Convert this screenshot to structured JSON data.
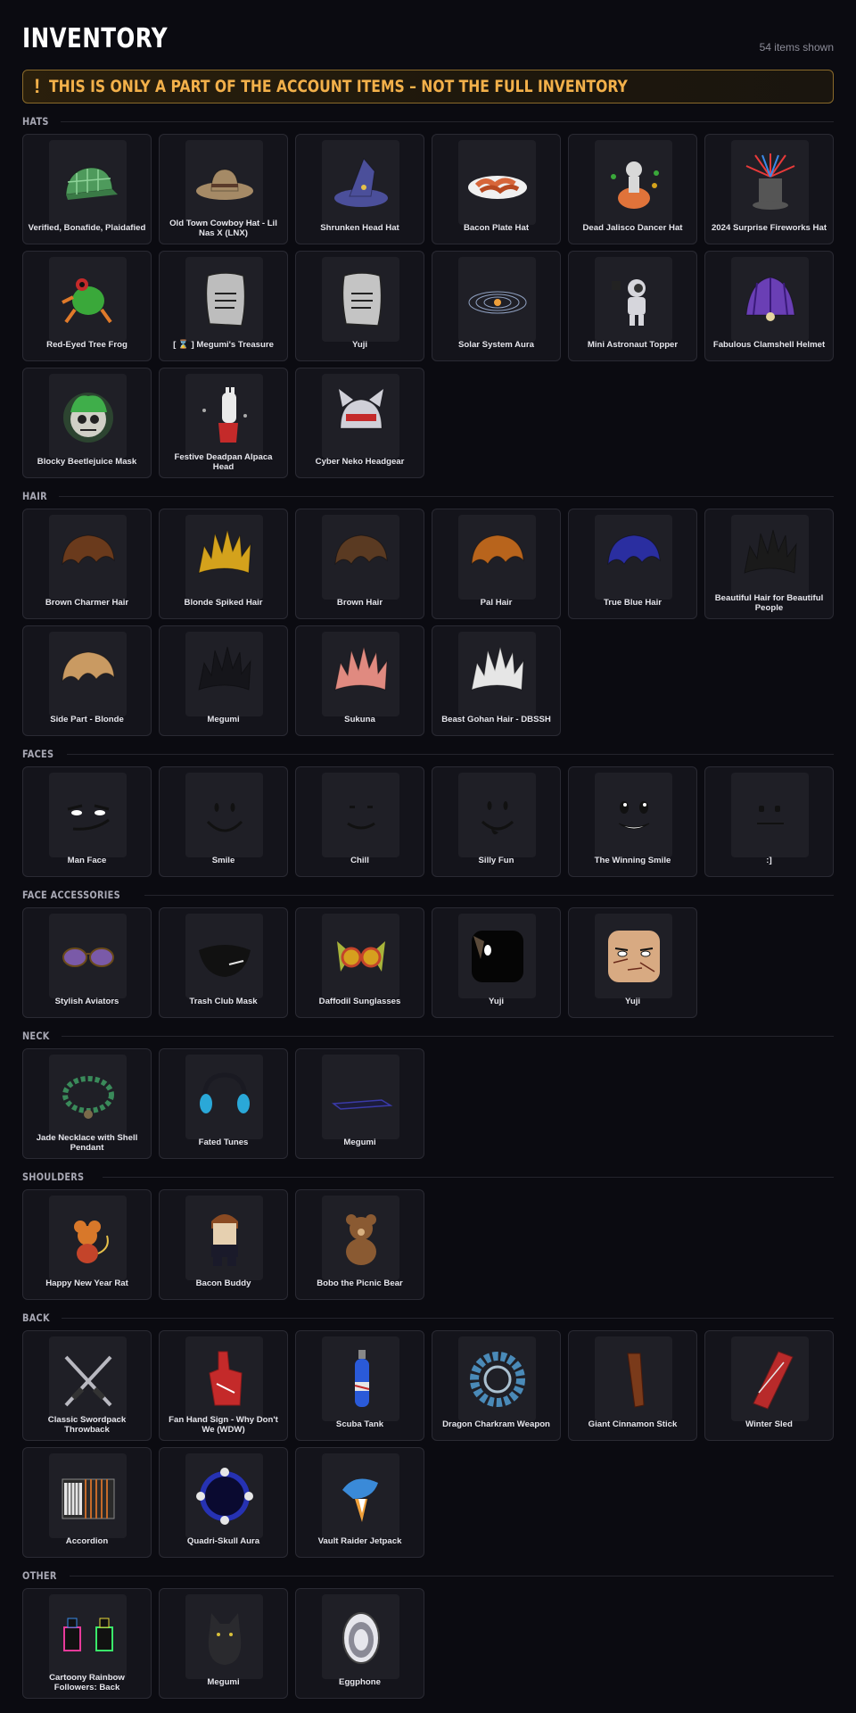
{
  "header": {
    "title": "INVENTORY",
    "count_label": "54 items shown"
  },
  "banner": {
    "icon": "!",
    "text": "THIS IS ONLY A PART OF THE ACCOUNT ITEMS – NOT THE FULL INVENTORY",
    "accent": "#f2b04a"
  },
  "sections": [
    {
      "title": "HATS",
      "items": [
        {
          "name": "Verified, Bonafide, Plaidafied",
          "icon": "plaid-cap-icon",
          "color": "#4e9a5c"
        },
        {
          "name": "Old Town Cowboy Hat - Lil Nas X (LNX)",
          "icon": "cowboy-hat-icon",
          "color": "#a58a66"
        },
        {
          "name": "Shrunken Head Hat",
          "icon": "witch-hat-icon",
          "color": "#4b4f9a"
        },
        {
          "name": "Bacon Plate Hat",
          "icon": "bacon-plate-icon",
          "color": "#d7663a"
        },
        {
          "name": "Dead Jalisco Dancer Hat",
          "icon": "skeleton-dancer-icon",
          "color": "#d8d8d8"
        },
        {
          "name": "2024 Surprise Fireworks Hat",
          "icon": "fireworks-top-hat-icon",
          "color": "#555555"
        },
        {
          "name": "Red-Eyed Tree Frog",
          "icon": "tree-frog-icon",
          "color": "#3aa83a"
        },
        {
          "name": "[ ⌛ ] Megumi's Treasure",
          "icon": "paper-note-icon",
          "color": "#bdbdbd"
        },
        {
          "name": "Yuji",
          "icon": "paper-note-icon",
          "color": "#c4c4c4"
        },
        {
          "name": "Solar System Aura",
          "icon": "solar-system-icon",
          "color": "#8fa0c0"
        },
        {
          "name": "Mini Astronaut Topper",
          "icon": "astronaut-icon",
          "color": "#d6d6dc"
        },
        {
          "name": "Fabulous Clamshell Helmet",
          "icon": "clamshell-icon",
          "color": "#6a3fb5"
        },
        {
          "name": "Blocky Beetlejuice Mask",
          "icon": "beetlejuice-mask-icon",
          "color": "#3fae4a"
        },
        {
          "name": "Festive Deadpan Alpaca Head",
          "icon": "alpaca-head-icon",
          "color": "#eaeaea"
        },
        {
          "name": "Cyber Neko Headgear",
          "icon": "cyber-neko-icon",
          "color": "#d0d0d8"
        }
      ]
    },
    {
      "title": "HAIR",
      "items": [
        {
          "name": "Brown Charmer Hair",
          "icon": "hair-icon",
          "color": "#6a3a1c"
        },
        {
          "name": "Blonde Spiked Hair",
          "icon": "spiked-hair-icon",
          "color": "#d4a21c"
        },
        {
          "name": "Brown Hair",
          "icon": "hair-icon",
          "color": "#5a3a22"
        },
        {
          "name": "Pal Hair",
          "icon": "hair-icon",
          "color": "#b8641c"
        },
        {
          "name": "True Blue Hair",
          "icon": "hair-icon",
          "color": "#2a2ea0"
        },
        {
          "name": "Beautiful Hair for Beautiful People",
          "icon": "spiked-hair-icon",
          "color": "#1a1a1a"
        },
        {
          "name": "Side Part - Blonde",
          "icon": "hair-icon",
          "color": "#c99a62"
        },
        {
          "name": "Megumi",
          "icon": "spiked-hair-icon",
          "color": "#15151a"
        },
        {
          "name": "Sukuna",
          "icon": "spiked-hair-icon",
          "color": "#e08a80"
        },
        {
          "name": "Beast Gohan Hair - DBSSH",
          "icon": "spiked-hair-icon",
          "color": "#e6e6e6"
        }
      ]
    },
    {
      "title": "FACES",
      "items": [
        {
          "name": "Man Face",
          "icon": "man-face-icon",
          "color": "#111111"
        },
        {
          "name": "Smile",
          "icon": "smile-face-icon",
          "color": "#111111"
        },
        {
          "name": "Chill",
          "icon": "chill-face-icon",
          "color": "#111111"
        },
        {
          "name": "Silly Fun",
          "icon": "silly-face-icon",
          "color": "#111111"
        },
        {
          "name": "The Winning Smile",
          "icon": "winning-smile-icon",
          "color": "#111111"
        },
        {
          "name": ":]",
          "icon": "flat-face-icon",
          "color": "#111111"
        }
      ]
    },
    {
      "title": "FACE ACCESSORIES",
      "items": [
        {
          "name": "Stylish Aviators",
          "icon": "aviators-icon",
          "color": "#7a5aa8"
        },
        {
          "name": "Trash Club Mask",
          "icon": "black-mask-icon",
          "color": "#111111"
        },
        {
          "name": "Daffodil Sunglasses",
          "icon": "daffodil-glasses-icon",
          "color": "#d6a01e"
        },
        {
          "name": "Yuji",
          "icon": "black-face-icon",
          "color": "#050505"
        },
        {
          "name": "Yuji",
          "icon": "skin-face-icon",
          "color": "#d8aa82"
        }
      ]
    },
    {
      "title": "NECK",
      "items": [
        {
          "name": "Jade Necklace with Shell Pendant",
          "icon": "necklace-icon",
          "color": "#3a8a5a"
        },
        {
          "name": "Fated Tunes",
          "icon": "headphones-icon",
          "color": "#2aa8d8"
        },
        {
          "name": "Megumi",
          "icon": "scarf-icon",
          "color": "#1c1c3a"
        }
      ]
    },
    {
      "title": "SHOULDERS",
      "items": [
        {
          "name": "Happy New Year Rat",
          "icon": "rat-icon",
          "color": "#d8782a"
        },
        {
          "name": "Bacon Buddy",
          "icon": "bacon-buddy-icon",
          "color": "#8a4a22"
        },
        {
          "name": "Bobo the Picnic Bear",
          "icon": "bear-icon",
          "color": "#8a5a32"
        }
      ]
    },
    {
      "title": "BACK",
      "items": [
        {
          "name": "Classic Swordpack Throwback",
          "icon": "crossed-swords-icon",
          "color": "#b8b8c0"
        },
        {
          "name": "Fan Hand Sign - Why Don't We (WDW)",
          "icon": "foam-finger-icon",
          "color": "#c42a2a"
        },
        {
          "name": "Scuba Tank",
          "icon": "scuba-tank-icon",
          "color": "#2a5ad8"
        },
        {
          "name": "Dragon Charkram Weapon",
          "icon": "chakram-icon",
          "color": "#4a8ab8"
        },
        {
          "name": "Giant Cinnamon Stick",
          "icon": "cinnamon-stick-icon",
          "color": "#7a3a1a"
        },
        {
          "name": "Winter Sled",
          "icon": "sled-icon",
          "color": "#b82a2a"
        },
        {
          "name": "Accordion",
          "icon": "accordion-icon",
          "color": "#2a2a2a"
        },
        {
          "name": "Quadri-Skull Aura",
          "icon": "skull-ring-icon",
          "color": "#2a3af0"
        },
        {
          "name": "Vault Raider Jetpack",
          "icon": "jetpack-icon",
          "color": "#3a8ad8"
        }
      ]
    },
    {
      "title": "OTHER",
      "items": [
        {
          "name": "Cartoony Rainbow Followers: Back",
          "icon": "rainbow-figures-icon",
          "color": "#111111"
        },
        {
          "name": "Megumi",
          "icon": "shadow-cat-icon",
          "color": "#2a2a2e"
        },
        {
          "name": "Eggphone",
          "icon": "eggphone-icon",
          "color": "#e6e6ec"
        }
      ]
    }
  ]
}
